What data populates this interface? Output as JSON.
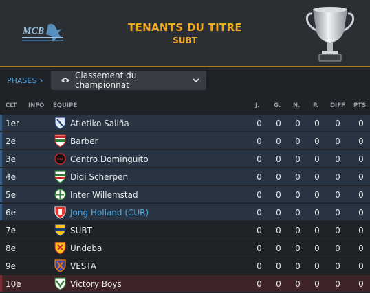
{
  "header": {
    "logo_text": "MCB",
    "title": "TENANTS DU TITRE",
    "subtitle": "SUBT"
  },
  "phases": {
    "link_label": "PHASES",
    "dropdown_label": "Classement du championnat"
  },
  "columns": {
    "pos": "CLT",
    "info": "INFO",
    "team": "ÉQUIPE",
    "played": "J.",
    "won": "G.",
    "drawn": "N.",
    "lost": "P.",
    "diff": "DIFF",
    "pts": "PTS"
  },
  "rows": [
    {
      "pos": "1er",
      "team": "Atletiko Saliña",
      "j": "0",
      "g": "0",
      "n": "0",
      "p": "0",
      "diff": "0",
      "pts": "0"
    },
    {
      "pos": "2e",
      "team": "Barber",
      "j": "0",
      "g": "0",
      "n": "0",
      "p": "0",
      "diff": "0",
      "pts": "0"
    },
    {
      "pos": "3e",
      "team": "Centro Dominguito",
      "j": "0",
      "g": "0",
      "n": "0",
      "p": "0",
      "diff": "0",
      "pts": "0"
    },
    {
      "pos": "4e",
      "team": "Didi Scherpen",
      "j": "0",
      "g": "0",
      "n": "0",
      "p": "0",
      "diff": "0",
      "pts": "0"
    },
    {
      "pos": "5e",
      "team": "Inter Willemstad",
      "j": "0",
      "g": "0",
      "n": "0",
      "p": "0",
      "diff": "0",
      "pts": "0"
    },
    {
      "pos": "6e",
      "team": "Jong Holland (CUR)",
      "j": "0",
      "g": "0",
      "n": "0",
      "p": "0",
      "diff": "0",
      "pts": "0"
    },
    {
      "pos": "7e",
      "team": "SUBT",
      "j": "0",
      "g": "0",
      "n": "0",
      "p": "0",
      "diff": "0",
      "pts": "0"
    },
    {
      "pos": "8e",
      "team": "Undeba",
      "j": "0",
      "g": "0",
      "n": "0",
      "p": "0",
      "diff": "0",
      "pts": "0"
    },
    {
      "pos": "9e",
      "team": "VESTA",
      "j": "0",
      "g": "0",
      "n": "0",
      "p": "0",
      "diff": "0",
      "pts": "0"
    },
    {
      "pos": "10e",
      "team": "Victory Boys",
      "j": "0",
      "g": "0",
      "n": "0",
      "p": "0",
      "diff": "0",
      "pts": "0"
    }
  ],
  "colors": {
    "accent_gold": "#f0a821",
    "link_blue": "#4da3e0",
    "qualify_zone": "#283441",
    "relegation_zone": "#3e2327"
  }
}
